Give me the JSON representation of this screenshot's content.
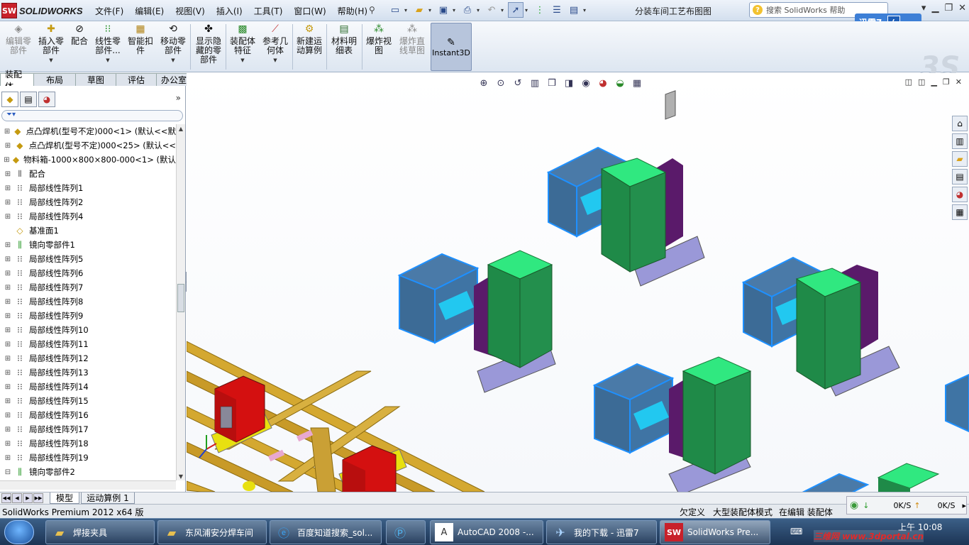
{
  "app": {
    "logo_text": "SOLIDWORKS",
    "logo_badge": "SW",
    "doc_title": "分装车间工艺布图图",
    "search_placeholder": "搜索 SolidWorks 帮助",
    "xunlei_label": "迅雷7"
  },
  "menu": [
    "文件(F)",
    "编辑(E)",
    "视图(V)",
    "插入(I)",
    "工具(T)",
    "窗口(W)",
    "帮助(H)"
  ],
  "commands": [
    {
      "label": "编辑零\n部件",
      "icon": "edit-component-icon",
      "disabled": true
    },
    {
      "label": "插入零\n部件",
      "icon": "insert-component-icon"
    },
    {
      "label": "配合",
      "icon": "mate-icon"
    },
    {
      "label": "线性零\n部件...",
      "icon": "linear-pattern-icon"
    },
    {
      "label": "智能扣\n件",
      "icon": "smart-fasteners-icon"
    },
    {
      "label": "移动零\n部件",
      "icon": "move-component-icon"
    },
    {
      "label": "显示隐\n藏的零\n部件",
      "icon": "show-hidden-icon"
    },
    {
      "label": "装配体\n特征",
      "icon": "assembly-feature-icon"
    },
    {
      "label": "参考几\n何体",
      "icon": "reference-geometry-icon"
    },
    {
      "label": "新建运\n动算例",
      "icon": "new-motion-study-icon"
    },
    {
      "label": "材料明\n细表",
      "icon": "bom-icon"
    },
    {
      "label": "爆炸视\n图",
      "icon": "exploded-view-icon"
    },
    {
      "label": "爆炸直\n线草图",
      "icon": "explode-line-sketch-icon",
      "disabled": true
    }
  ],
  "instant3d": "Instant3D",
  "tabs": [
    "装配体",
    "布局",
    "草图",
    "评估",
    "办公室产品"
  ],
  "tree": [
    {
      "text": "点凸焊机(型号不定)000<1> (默认<<默",
      "icon": "part"
    },
    {
      "text": "点凸焊机(型号不定)000<25> (默认<<",
      "icon": "part"
    },
    {
      "text": "物料箱-1000×800×800-000<1> (默认",
      "icon": "part"
    },
    {
      "text": "配合",
      "icon": "mate"
    },
    {
      "text": "局部线性阵列1",
      "icon": "pattern"
    },
    {
      "text": "局部线性阵列2",
      "icon": "pattern"
    },
    {
      "text": "局部线性阵列4",
      "icon": "pattern"
    },
    {
      "text": "基准面1",
      "icon": "plane"
    },
    {
      "text": "镜向零部件1",
      "icon": "mirror"
    },
    {
      "text": "局部线性阵列5",
      "icon": "pattern"
    },
    {
      "text": "局部线性阵列6",
      "icon": "pattern"
    },
    {
      "text": "局部线性阵列7",
      "icon": "pattern"
    },
    {
      "text": "局部线性阵列8",
      "icon": "pattern"
    },
    {
      "text": "局部线性阵列9",
      "icon": "pattern"
    },
    {
      "text": "局部线性阵列10",
      "icon": "pattern"
    },
    {
      "text": "局部线性阵列11",
      "icon": "pattern"
    },
    {
      "text": "局部线性阵列12",
      "icon": "pattern"
    },
    {
      "text": "局部线性阵列13",
      "icon": "pattern"
    },
    {
      "text": "局部线性阵列14",
      "icon": "pattern"
    },
    {
      "text": "局部线性阵列15",
      "icon": "pattern"
    },
    {
      "text": "局部线性阵列16",
      "icon": "pattern"
    },
    {
      "text": "局部线性阵列17",
      "icon": "pattern"
    },
    {
      "text": "局部线性阵列18",
      "icon": "pattern"
    },
    {
      "text": "局部线性阵列19",
      "icon": "pattern"
    },
    {
      "text": "镜向零部件2",
      "icon": "mirror"
    }
  ],
  "bottom_tabs": [
    "模型",
    "运动算例 1"
  ],
  "status": {
    "product": "SolidWorks Premium 2012 x64 版",
    "s2": "欠定义",
    "s3": "大型装配体模式",
    "s4": "在编辑 装配体"
  },
  "net": {
    "down": "0K/S",
    "up": "0K/S"
  },
  "taskbar": [
    {
      "label": "焊接夹具",
      "icon": "folder-icon"
    },
    {
      "label": "东风浦安分焊车间",
      "icon": "folder-icon"
    },
    {
      "label": "百度知道搜索_sol...",
      "icon": "ie-icon"
    },
    {
      "label": "",
      "icon": "pp-icon"
    },
    {
      "label": "AutoCAD 2008 -...",
      "icon": "autocad-icon"
    },
    {
      "label": "我的下载 - 迅雷7",
      "icon": "xunlei-icon"
    },
    {
      "label": "SolidWorks Pre...",
      "icon": "solidworks-icon"
    }
  ],
  "clock": {
    "time": "上午 10:08"
  },
  "watermark": "三维网 www.3dportal.cn"
}
